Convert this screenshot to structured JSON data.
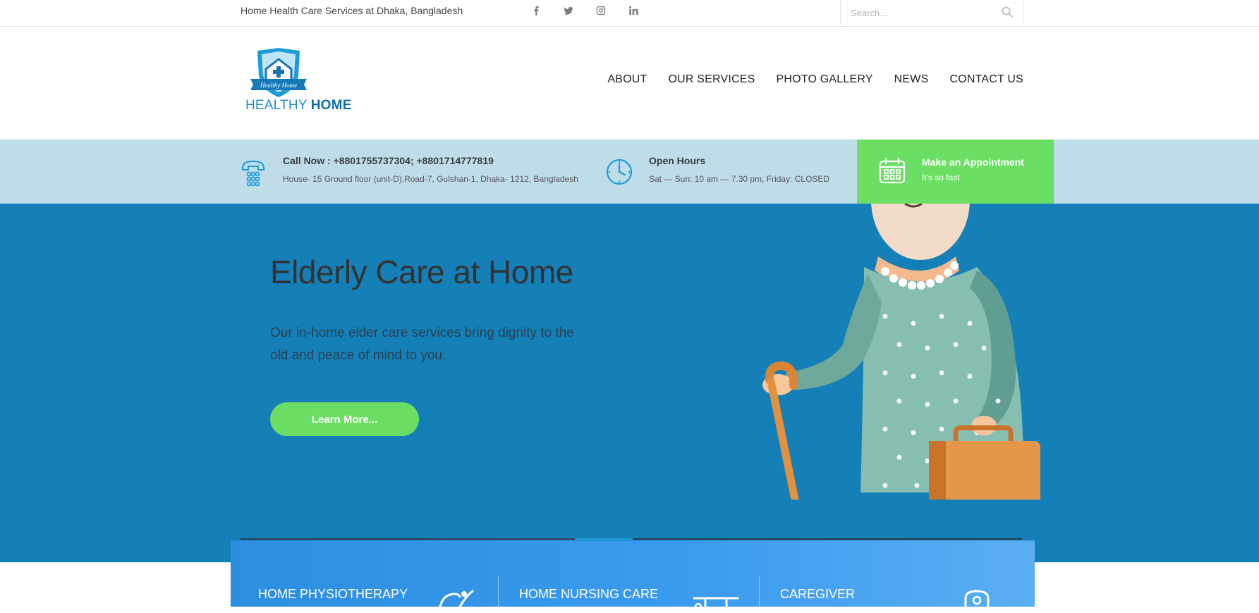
{
  "topbar": {
    "tagline": "Home Health Care Services at Dhaka, Bangladesh",
    "search_placeholder": "Search..."
  },
  "logo": {
    "badge_text": "Healthy Home",
    "word1": "HEALTHY",
    "word2": "HOME"
  },
  "nav": [
    "ABOUT",
    "OUR SERVICES",
    "PHOTO GALLERY",
    "NEWS",
    "CONTACT US"
  ],
  "info": {
    "call_title": "Call Now : +8801755737304; +8801714777819",
    "address": "House- 15 Ground floor (unit-D),Road-7, Gulshan-1, Dhaka- 1212, Bangladesh",
    "hours_title": "Open Hours",
    "hours": "Sat — Sun: 10 am — 7.30 pm, Friday: CLOSED"
  },
  "appointment": {
    "title": "Make an Appointment",
    "subtitle": "It's so fast"
  },
  "hero": {
    "title": "Elderly Care at Home",
    "description": "Our in-home elder care services bring dignity to the old and peace of mind to you.",
    "button": "Learn More..."
  },
  "services": [
    "HOME PHYSIOTHERAPY",
    "HOME NURSING CARE",
    "CAREGIVER"
  ],
  "colors": {
    "primary_blue": "#157fb7",
    "accent_green": "#6bde64",
    "info_strip": "#bfdce9",
    "icon_blue": "#1e9cd8"
  },
  "icons": {
    "social": [
      "facebook-icon",
      "twitter-icon",
      "instagram-icon",
      "linkedin-icon"
    ],
    "search": "search-icon",
    "phone": "phone-icon",
    "clock": "clock-icon",
    "calendar": "calendar-icon"
  }
}
